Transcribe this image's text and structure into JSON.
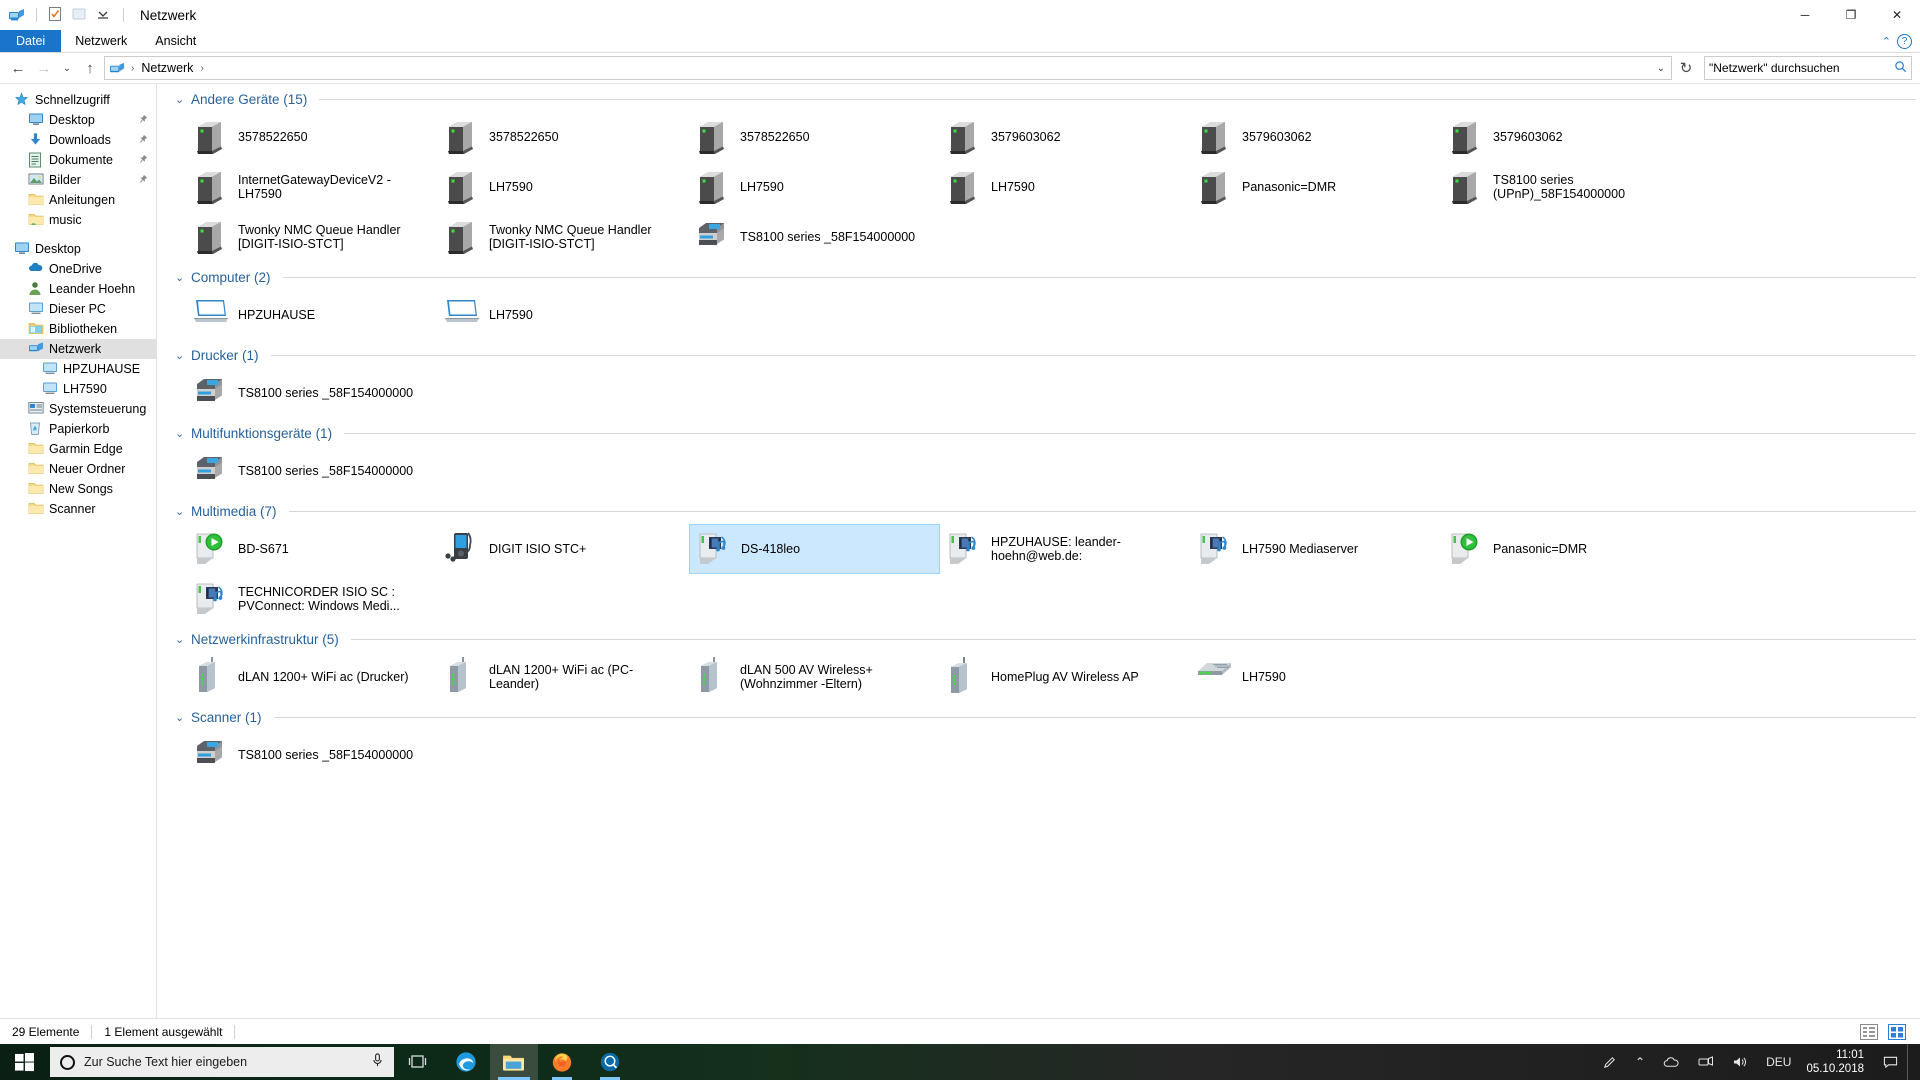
{
  "window": {
    "title": "Netzwerk",
    "minimize": "─",
    "maximize": "❐",
    "close": "✕",
    "quick_access_icons": [
      "network-icon",
      "properties-icon",
      "new-folder-icon",
      "customize-chevron-icon"
    ]
  },
  "ribbon": {
    "tabs": [
      {
        "label": "Datei",
        "active": true
      },
      {
        "label": "Netzwerk",
        "active": false
      },
      {
        "label": "Ansicht",
        "active": false
      }
    ],
    "minimize_ribbon": "⌃",
    "help": "?"
  },
  "address_bar": {
    "back": "←",
    "forward": "→",
    "recent": "⌄",
    "up": "↑",
    "root_icon": "network-icon",
    "crumbs": [
      "Netzwerk"
    ],
    "crumb_separator": "›",
    "dropdown": "⌄",
    "refresh": "↻",
    "search_placeholder": "\"Netzwerk\" durchsuchen",
    "search_value": ""
  },
  "sidebar": {
    "items": [
      {
        "label": "Schnellzugriff",
        "icon": "star-icon",
        "level": 0,
        "selected": false,
        "pinned": false,
        "gap_before": false
      },
      {
        "label": "Desktop",
        "icon": "monitor-icon",
        "level": 1,
        "selected": false,
        "pinned": true,
        "gap_before": false
      },
      {
        "label": "Downloads",
        "icon": "download-icon",
        "level": 1,
        "selected": false,
        "pinned": true,
        "gap_before": false
      },
      {
        "label": "Dokumente",
        "icon": "document-icon",
        "level": 1,
        "selected": false,
        "pinned": true,
        "gap_before": false
      },
      {
        "label": "Bilder",
        "icon": "pictures-icon",
        "level": 1,
        "selected": false,
        "pinned": true,
        "gap_before": false
      },
      {
        "label": "Anleitungen",
        "icon": "folder-icon",
        "level": 1,
        "selected": false,
        "pinned": false,
        "gap_before": false
      },
      {
        "label": "music",
        "icon": "music-folder-icon",
        "level": 1,
        "selected": false,
        "pinned": false,
        "gap_before": false
      },
      {
        "label": "Desktop",
        "icon": "monitor-icon",
        "level": 0,
        "selected": false,
        "pinned": false,
        "gap_before": true
      },
      {
        "label": "OneDrive",
        "icon": "cloud-icon",
        "level": 1,
        "selected": false,
        "pinned": false,
        "gap_before": false
      },
      {
        "label": "Leander Hoehn",
        "icon": "user-icon",
        "level": 1,
        "selected": false,
        "pinned": false,
        "gap_before": false
      },
      {
        "label": "Dieser PC",
        "icon": "pc-icon",
        "level": 1,
        "selected": false,
        "pinned": false,
        "gap_before": false
      },
      {
        "label": "Bibliotheken",
        "icon": "libraries-icon",
        "level": 1,
        "selected": false,
        "pinned": false,
        "gap_before": false
      },
      {
        "label": "Netzwerk",
        "icon": "network-icon",
        "level": 1,
        "selected": true,
        "pinned": false,
        "gap_before": false
      },
      {
        "label": "HPZUHAUSE",
        "icon": "pc-icon",
        "level": 2,
        "selected": false,
        "pinned": false,
        "gap_before": false
      },
      {
        "label": "LH7590",
        "icon": "pc-icon",
        "level": 2,
        "selected": false,
        "pinned": false,
        "gap_before": false
      },
      {
        "label": "Systemsteuerung",
        "icon": "control-panel-icon",
        "level": 1,
        "selected": false,
        "pinned": false,
        "gap_before": false
      },
      {
        "label": "Papierkorb",
        "icon": "recycle-bin-icon",
        "level": 1,
        "selected": false,
        "pinned": false,
        "gap_before": false
      },
      {
        "label": "Garmin Edge",
        "icon": "folder-icon",
        "level": 1,
        "selected": false,
        "pinned": false,
        "gap_before": false
      },
      {
        "label": "Neuer Ordner",
        "icon": "folder-icon",
        "level": 1,
        "selected": false,
        "pinned": false,
        "gap_before": false
      },
      {
        "label": "New Songs",
        "icon": "folder-icon",
        "level": 1,
        "selected": false,
        "pinned": false,
        "gap_before": false
      },
      {
        "label": "Scanner",
        "icon": "folder-icon",
        "level": 1,
        "selected": false,
        "pinned": false,
        "gap_before": false
      }
    ]
  },
  "groups": [
    {
      "title": "Andere Geräte (15)",
      "collapsed": false,
      "items": [
        {
          "label": "3578522650",
          "icon": "tower-device-icon",
          "selected": false
        },
        {
          "label": "3578522650",
          "icon": "tower-device-icon",
          "selected": false
        },
        {
          "label": "3578522650",
          "icon": "tower-device-icon",
          "selected": false
        },
        {
          "label": "3579603062",
          "icon": "tower-device-icon",
          "selected": false
        },
        {
          "label": "3579603062",
          "icon": "tower-device-icon",
          "selected": false
        },
        {
          "label": "3579603062",
          "icon": "tower-device-icon",
          "selected": false
        },
        {
          "label": "InternetGatewayDeviceV2 - LH7590",
          "icon": "tower-device-icon",
          "selected": false
        },
        {
          "label": "LH7590",
          "icon": "tower-device-icon",
          "selected": false
        },
        {
          "label": "LH7590",
          "icon": "tower-device-icon",
          "selected": false
        },
        {
          "label": "LH7590",
          "icon": "tower-device-icon",
          "selected": false
        },
        {
          "label": "Panasonic=DMR",
          "icon": "tower-device-icon",
          "selected": false
        },
        {
          "label": "TS8100 series (UPnP)_58F154000000",
          "icon": "tower-device-icon",
          "selected": false
        },
        {
          "label": "Twonky NMC Queue Handler [DIGIT-ISIO-STCT]",
          "icon": "tower-device-icon",
          "selected": false
        },
        {
          "label": "Twonky NMC Queue Handler [DIGIT-ISIO-STCT]",
          "icon": "tower-device-icon",
          "selected": false
        },
        {
          "label": "TS8100 series _58F154000000",
          "icon": "printer-icon",
          "selected": false
        }
      ]
    },
    {
      "title": "Computer (2)",
      "collapsed": false,
      "items": [
        {
          "label": "HPZUHAUSE",
          "icon": "computer-icon",
          "selected": false
        },
        {
          "label": "LH7590",
          "icon": "computer-icon",
          "selected": false
        }
      ]
    },
    {
      "title": "Drucker (1)",
      "collapsed": false,
      "items": [
        {
          "label": "TS8100 series _58F154000000",
          "icon": "printer-icon",
          "selected": false
        }
      ]
    },
    {
      "title": "Multifunktionsgeräte (1)",
      "collapsed": false,
      "items": [
        {
          "label": "TS8100 series _58F154000000",
          "icon": "printer-icon",
          "selected": false
        }
      ]
    },
    {
      "title": "Multimedia (7)",
      "collapsed": false,
      "items": [
        {
          "label": "BD-S671",
          "icon": "media-play-device-icon",
          "selected": false
        },
        {
          "label": "DIGIT ISIO STC+",
          "icon": "media-player-icon",
          "selected": false
        },
        {
          "label": "DS-418leo",
          "icon": "media-server-icon",
          "selected": true
        },
        {
          "label": "HPZUHAUSE: leander-hoehn@web.de:",
          "icon": "media-server-icon",
          "selected": false
        },
        {
          "label": "LH7590 Mediaserver",
          "icon": "media-server-icon",
          "selected": false
        },
        {
          "label": "Panasonic=DMR",
          "icon": "media-play-device-icon",
          "selected": false
        },
        {
          "label": "TECHNICORDER ISIO SC : PVConnect: Windows Medi...",
          "icon": "media-server-icon",
          "selected": false
        }
      ]
    },
    {
      "title": "Netzwerkinfrastruktur (5)",
      "collapsed": false,
      "items": [
        {
          "label": "dLAN 1200+ WiFi ac (Drucker)",
          "icon": "powerline-adapter-icon",
          "selected": false
        },
        {
          "label": "dLAN 1200+ WiFi ac (PC-Leander)",
          "icon": "powerline-adapter-icon",
          "selected": false
        },
        {
          "label": "dLAN 500 AV Wireless+ (Wohnzimmer -Eltern)",
          "icon": "powerline-adapter-icon",
          "selected": false
        },
        {
          "label": "HomePlug AV Wireless AP",
          "icon": "wireless-ap-icon",
          "selected": false
        },
        {
          "label": "LH7590",
          "icon": "router-icon",
          "selected": false
        }
      ]
    },
    {
      "title": "Scanner (1)",
      "collapsed": false,
      "items": [
        {
          "label": "TS8100 series _58F154000000",
          "icon": "printer-icon",
          "selected": false
        }
      ]
    }
  ],
  "status_bar": {
    "item_count": "29 Elemente",
    "selection": "1 Element ausgewählt",
    "view_details_icon": "details-view-icon",
    "view_large_icons_icon": "large-icons-view-icon"
  },
  "taskbar": {
    "start": "start-icon",
    "search_placeholder": "Zur Suche Text hier eingeben",
    "mic_icon": "microphone-icon",
    "task_view_icon": "task-view-icon",
    "pinned": [
      {
        "name": "edge-icon",
        "running": false,
        "active": false
      },
      {
        "name": "file-explorer-icon",
        "running": true,
        "active": true
      },
      {
        "name": "firefox-icon",
        "running": true,
        "active": false
      },
      {
        "name": "garmin-express-icon",
        "running": true,
        "active": false
      }
    ],
    "tray": {
      "pen_icon": "pen-input-icon",
      "overflow_icon": "⌃",
      "onedrive_icon": "cloud-icon",
      "network_icon": "network-tray-icon",
      "volume_icon": "speaker-icon",
      "language": "DEU",
      "time": "11:01",
      "date": "05.10.2018",
      "notifications_icon": "action-center-icon"
    }
  },
  "colors": {
    "accent": "#1a74c9",
    "group_title": "#26619c",
    "selection_fill": "#cce8ff",
    "selection_border": "#99d1ff",
    "sidebar_selected": "#e0e0e0"
  }
}
